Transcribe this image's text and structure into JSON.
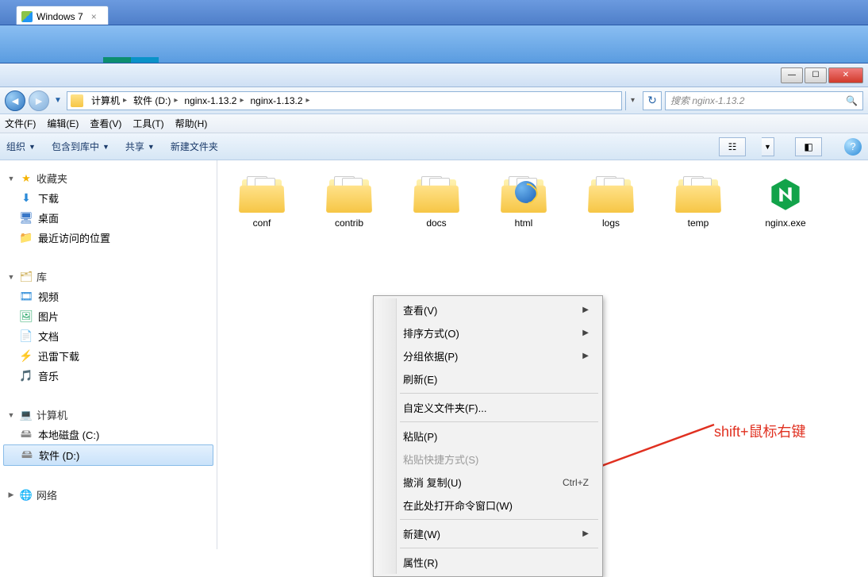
{
  "outer_tab": {
    "label": "Windows 7"
  },
  "window_controls": {
    "min": "—",
    "max": "☐",
    "close": "✕"
  },
  "breadcrumb": {
    "segs": [
      "计算机",
      "软件 (D:)",
      "nginx-1.13.2",
      "nginx-1.13.2"
    ]
  },
  "search": {
    "placeholder": "搜索 nginx-1.13.2"
  },
  "menubar": [
    "文件(F)",
    "编辑(E)",
    "查看(V)",
    "工具(T)",
    "帮助(H)"
  ],
  "toolbar": {
    "organize": "组织",
    "include": "包含到库中",
    "share": "共享",
    "newfolder": "新建文件夹"
  },
  "sidebar": {
    "favorites": {
      "label": "收藏夹",
      "items": [
        {
          "k": "dl",
          "label": "下载"
        },
        {
          "k": "desk",
          "label": "桌面"
        },
        {
          "k": "recent",
          "label": "最近访问的位置"
        }
      ]
    },
    "libraries": {
      "label": "库",
      "items": [
        {
          "k": "vid",
          "label": "视频"
        },
        {
          "k": "pic",
          "label": "图片"
        },
        {
          "k": "doc",
          "label": "文档"
        },
        {
          "k": "thunder",
          "label": "迅雷下载"
        },
        {
          "k": "music",
          "label": "音乐"
        }
      ]
    },
    "computer": {
      "label": "计算机",
      "items": [
        {
          "k": "diskc",
          "label": "本地磁盘 (C:)"
        },
        {
          "k": "diskd",
          "label": "软件 (D:)",
          "selected": true
        }
      ]
    },
    "network": {
      "label": "网络"
    }
  },
  "files": [
    {
      "name": "conf",
      "type": "folder"
    },
    {
      "name": "contrib",
      "type": "folder"
    },
    {
      "name": "docs",
      "type": "folder"
    },
    {
      "name": "html",
      "type": "folder-html"
    },
    {
      "name": "logs",
      "type": "folder"
    },
    {
      "name": "temp",
      "type": "folder"
    },
    {
      "name": "nginx.exe",
      "type": "exe"
    }
  ],
  "ctx": {
    "view": "查看(V)",
    "sort": "排序方式(O)",
    "group": "分组依据(P)",
    "refresh": "刷新(E)",
    "customize": "自定义文件夹(F)...",
    "paste": "粘贴(P)",
    "paste_shortcut": "粘贴快捷方式(S)",
    "undo": "撤消 复制(U)",
    "undo_sc": "Ctrl+Z",
    "open_cmd": "在此处打开命令窗口(W)",
    "new": "新建(W)",
    "props": "属性(R)"
  },
  "annotation": "shift+鼠标右键"
}
